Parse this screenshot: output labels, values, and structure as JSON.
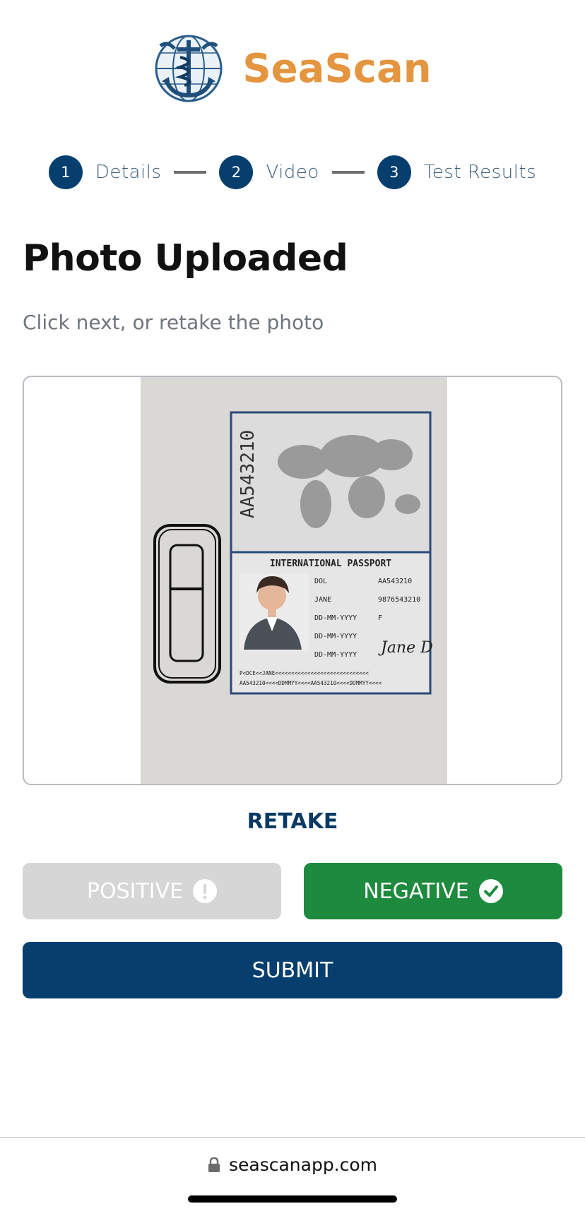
{
  "brand": {
    "name": "SeaScan",
    "color": "#e4953f",
    "logo_icon": "anchor-caduceus-globe-icon"
  },
  "stepper": {
    "steps": [
      {
        "number": "1",
        "label": "Details"
      },
      {
        "number": "2",
        "label": "Video"
      },
      {
        "number": "3",
        "label": "Test Results"
      }
    ]
  },
  "page": {
    "title": "Photo Uploaded",
    "subtitle": "Click next, or retake the photo"
  },
  "photo": {
    "passport_number_vertical": "AA543210",
    "passport_heading": "INTERNATIONAL PASSPORT",
    "fields": [
      "DOL",
      "AA543210",
      "JANE",
      "9876543210",
      "DD-MM-YYYY",
      "F",
      "DD-MM-YYYY",
      "DD-MM-YYYY"
    ],
    "mrz_line1": "P<DCE<<JANE<<<<<<<<<<<<<<<<<<<<<<<<<<<<<",
    "mrz_line2": "AA543210<<<<DDMMYY<<<<AA543210<<<<DDMMYY<<<<",
    "signature": "Jane D"
  },
  "actions": {
    "retake_label": "RETAKE",
    "positive_label": "POSITIVE",
    "negative_label": "NEGATIVE",
    "submit_label": "SUBMIT",
    "selected_result": "NEGATIVE"
  },
  "browser": {
    "url": "seascanapp.com",
    "lock_icon": "lock-icon"
  },
  "colors": {
    "primary": "#063f6e",
    "positive_disabled": "#d6d6d6",
    "negative_selected": "#1e8a3e"
  }
}
